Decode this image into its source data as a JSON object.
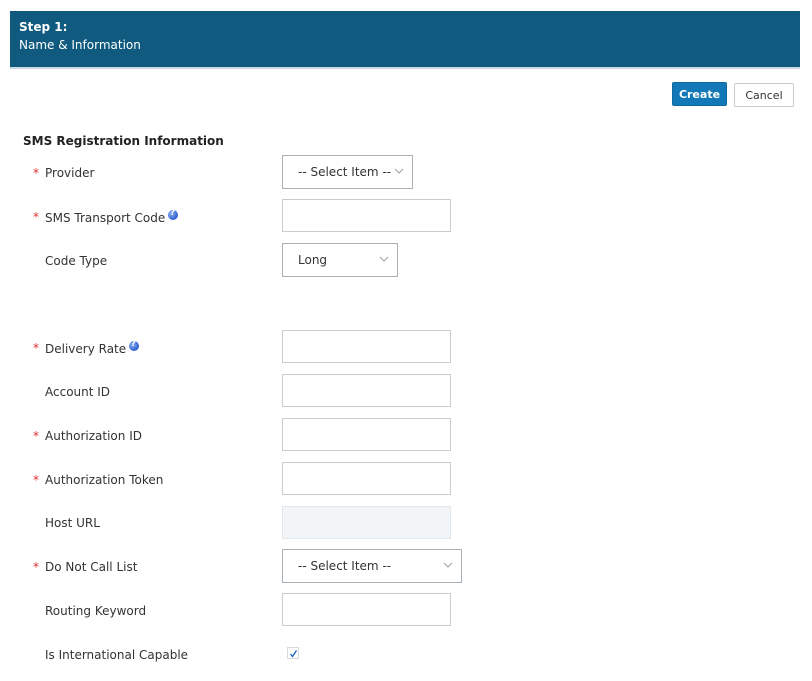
{
  "header": {
    "step": "Step 1:",
    "subtitle": "Name & Information"
  },
  "toolbar": {
    "create_label": "Create",
    "cancel_label": "Cancel"
  },
  "section": {
    "title": "SMS Registration Information"
  },
  "fields": {
    "provider": {
      "label": "Provider",
      "required": true,
      "value": "-- Select Item --"
    },
    "transport_code": {
      "label": "SMS Transport Code",
      "required": true,
      "value": "",
      "help": true
    },
    "code_type": {
      "label": "Code Type",
      "required": false,
      "value": "Long"
    },
    "delivery_rate": {
      "label": "Delivery Rate",
      "required": true,
      "value": "",
      "help": true
    },
    "account_id": {
      "label": "Account ID",
      "required": false,
      "value": ""
    },
    "authorization_id": {
      "label": "Authorization ID",
      "required": true,
      "value": ""
    },
    "authorization_token": {
      "label": "Authorization Token",
      "required": true,
      "value": ""
    },
    "host_url": {
      "label": "Host URL",
      "required": false,
      "value": "",
      "disabled": true
    },
    "do_not_call_list": {
      "label": "Do Not Call List",
      "required": true,
      "value": "-- Select Item --"
    },
    "routing_keyword": {
      "label": "Routing Keyword",
      "required": false,
      "value": ""
    },
    "international_capable": {
      "label": "Is International Capable",
      "required": false,
      "checked": true
    }
  },
  "required_marker": "*",
  "colors": {
    "header_bg": "#0f5a7e",
    "primary_button": "#1278b8",
    "required": "#e0302f",
    "disabled_input_bg": "#f1f5f8",
    "check_mark": "#1f63c6"
  }
}
